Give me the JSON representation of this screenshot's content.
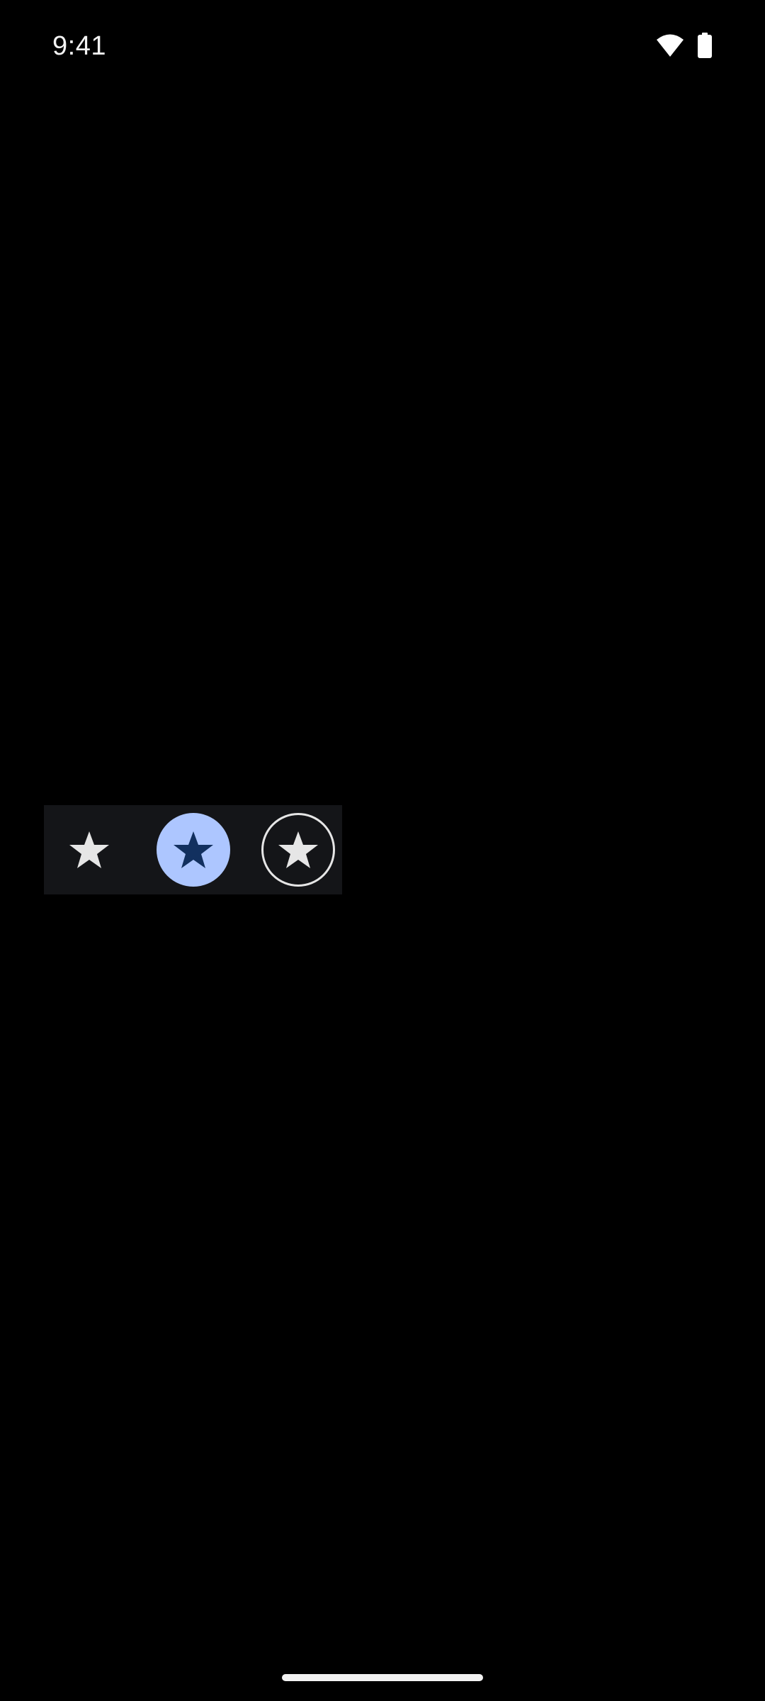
{
  "status_bar": {
    "time": "9:41",
    "icons": [
      "wifi-icon",
      "battery-icon"
    ]
  },
  "icon_buttons": [
    {
      "variant": "standard",
      "icon": "star-icon",
      "icon_color": "#e6e6e6"
    },
    {
      "variant": "filled",
      "icon": "star-icon",
      "icon_color": "#12305f",
      "container_color": "#adc6ff"
    },
    {
      "variant": "outlined",
      "icon": "star-icon",
      "icon_color": "#e6e6e6",
      "outline_color": "#e6e6e6"
    }
  ],
  "colors": {
    "background": "#000000",
    "row_surface": "#141518",
    "accent": "#adc6ff"
  }
}
